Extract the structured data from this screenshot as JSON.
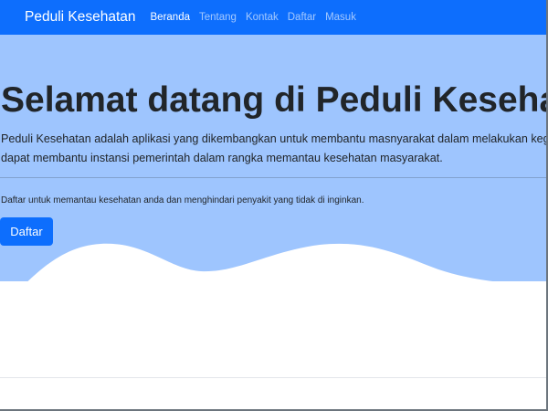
{
  "navbar": {
    "brand": "Peduli Kesehatan",
    "links": [
      {
        "label": "Beranda",
        "active": true
      },
      {
        "label": "Tentang",
        "active": false
      },
      {
        "label": "Kontak",
        "active": false
      },
      {
        "label": "Daftar",
        "active": false
      },
      {
        "label": "Masuk",
        "active": false
      }
    ],
    "color": "#0d6efd"
  },
  "hero": {
    "title": "Selamat datang di Peduli Kesehatan",
    "lead_line1": "Peduli Kesehatan adalah aplikasi yang dikembangkan untuk membantu masnyarakat dalam melakukan kegiata",
    "lead_line2": "dapat membantu instansi pemerintah dalam rangka memantau kesehatan masyarakat.",
    "subtext": "Daftar untuk memantau kesehatan anda dan menghindari penyakit yang tidak di inginkan.",
    "button_label": "Daftar",
    "background": "#9ec5fe"
  }
}
